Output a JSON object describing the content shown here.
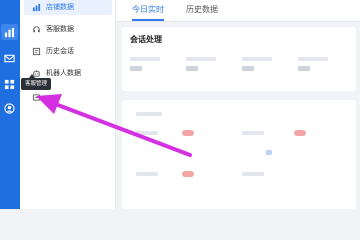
{
  "menu": {
    "items": [
      {
        "label": "店铺数据",
        "icon": "store-chart-icon",
        "active": true
      },
      {
        "label": "客服数据",
        "icon": "headset-icon",
        "active": false
      },
      {
        "label": "历史会话",
        "icon": "history-icon",
        "active": false
      },
      {
        "label": "机器人数据",
        "icon": "robot-icon",
        "active": false
      },
      {
        "label": "客服管理",
        "icon": "service-manage-icon",
        "active": false
      }
    ],
    "tooltip": "客服管理"
  },
  "tabs": [
    {
      "label": "今日实时",
      "active": true
    },
    {
      "label": "历史数据",
      "active": false
    }
  ],
  "sections": {
    "session_title": "会话处理"
  },
  "colors": {
    "accent": "#2f7bea",
    "rail": "#1f6fe0",
    "annotation_arrow": "#d42fe0"
  }
}
